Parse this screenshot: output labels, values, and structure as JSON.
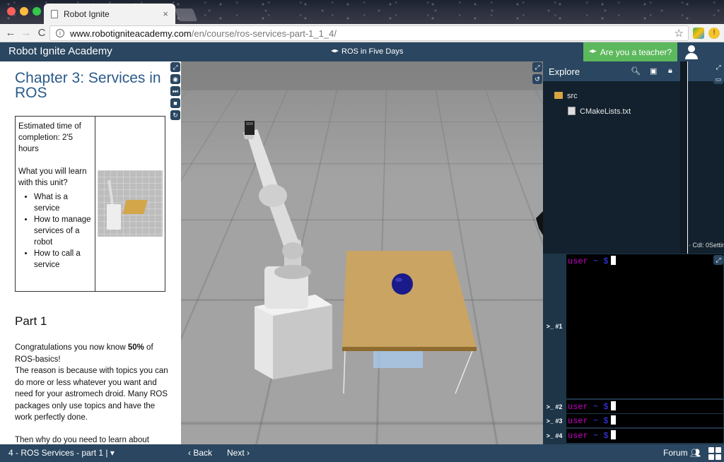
{
  "browser": {
    "tab_title": "Robot Ignite",
    "tab_close": "×",
    "url_host": "www.robotigniteacademy.com",
    "url_path": "/en/course/ros-services-part-1_1_4/",
    "back_glyph": "←",
    "forward_glyph": "→",
    "reload_glyph": "C",
    "star_glyph": "☆"
  },
  "header": {
    "brand": "Robot Ignite Academy",
    "course": "ROS in Five Days",
    "teacher_button": "Are you a teacher?"
  },
  "notebook": {
    "chapter_title": "Chapter 3: Services in ROS",
    "estimated_time": "Estimated time of completion: 2'5 hours",
    "learn_heading": "What you will learn with this unit?",
    "learn_items": [
      "What is a service",
      "How to manage services of a robot",
      "How to call a service"
    ],
    "part_title": "Part 1",
    "para1_pre": "Congratulations you now know ",
    "para1_bold": "50%",
    "para1_post": " of ROS-basics!",
    "para2": "The reason is because with topics you can do more or less whatever you want and need for your astromech droid. Many ROS packages only use topics and have the work perfectly done.",
    "para3": "Then why do you need to learn about"
  },
  "ide": {
    "title": "Explore",
    "tree": [
      {
        "name": "src",
        "type": "folder"
      },
      {
        "name": "CMakeLists.txt",
        "type": "file"
      }
    ],
    "right_label": "· Cdl: 0Settin"
  },
  "shells": [
    {
      "label": ">_ #1",
      "prompt_user": "user",
      "prompt_tilde": "~",
      "prompt_sym": "$"
    },
    {
      "label": ">_ #2",
      "prompt_user": "user",
      "prompt_tilde": "~",
      "prompt_sym": "$"
    },
    {
      "label": ">_ #3",
      "prompt_user": "user",
      "prompt_tilde": "~",
      "prompt_sym": "$"
    },
    {
      "label": ">_ #4",
      "prompt_user": "user",
      "prompt_tilde": "~",
      "prompt_sym": "$"
    }
  ],
  "bottom": {
    "unit_select": "4 - ROS Services - part 1 | ▾",
    "back": "‹ Back",
    "next": "Next ›",
    "forum": "Forum"
  },
  "colors": {
    "brand_blue": "#2a4660",
    "teacher_green": "#5cb85c",
    "title_blue": "#2a5a8a",
    "prompt_magenta": "#c800c8"
  }
}
